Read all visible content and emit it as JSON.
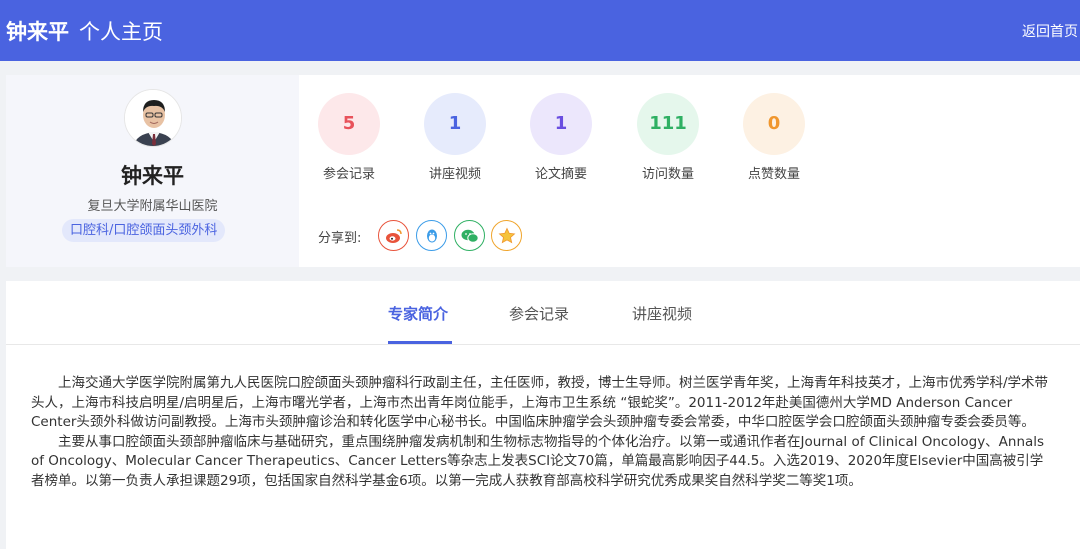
{
  "header": {
    "name": "钟来平",
    "subtitle": "个人主页",
    "back_label": "返回首页"
  },
  "profile": {
    "name": "钟来平",
    "hospital": "复旦大学附属华山医院",
    "department": "口腔科/口腔颌面头颈外科"
  },
  "stats": [
    {
      "value": "5",
      "label": "参会记录",
      "color": "#e8525b",
      "bg": "#fde8ea"
    },
    {
      "value": "1",
      "label": "讲座视频",
      "color": "#4a63e0",
      "bg": "#e6ebfc"
    },
    {
      "value": "1",
      "label": "论文摘要",
      "color": "#6a4ee0",
      "bg": "#ece7fc"
    },
    {
      "value": "111",
      "label": "访问数量",
      "color": "#2fb063",
      "bg": "#e5f7ec"
    },
    {
      "value": "0",
      "label": "点赞数量",
      "color": "#f0962d",
      "bg": "#fdf1e3"
    }
  ],
  "share": {
    "label": "分享到:",
    "targets": [
      {
        "name": "weibo",
        "color": "#e8533b"
      },
      {
        "name": "qq",
        "color": "#3b9ce8"
      },
      {
        "name": "wechat",
        "color": "#2fb063"
      },
      {
        "name": "favorite",
        "color": "#f0a52d"
      }
    ]
  },
  "tabs": [
    {
      "label": "专家简介",
      "active": true
    },
    {
      "label": "参会记录",
      "active": false
    },
    {
      "label": "讲座视频",
      "active": false
    }
  ],
  "bio": {
    "paragraph1": "上海交通大学医学院附属第九人民医院口腔颌面头颈肿瘤科行政副主任，主任医师，教授，博士生导师。树兰医学青年奖，上海青年科技英才，上海市优秀学科/学术带头人，上海市科技启明星/启明星后，上海市曙光学者，上海市杰出青年岗位能手，上海市卫生系统 “银蛇奖”。2011-2012年赴美国德州大学MD Anderson Cancer Center头颈外科做访问副教授。上海市头颈肿瘤诊治和转化医学中心秘书长。中国临床肿瘤学会头颈肿瘤专委会常委，中华口腔医学会口腔颌面头颈肿瘤专委会委员等。",
    "paragraph2": "主要从事口腔颌面头颈部肿瘤临床与基础研究，重点围绕肿瘤发病机制和生物标志物指导的个体化治疗。以第一或通讯作者在Journal of Clinical Oncology、Annals of Oncology、Molecular Cancer Therapeutics、Cancer Letters等杂志上发表SCI论文70篇，单篇最高影响因子44.5。入选2019、2020年度Elsevier中国高被引学者榜单。以第一负责人承担课题29项，包括国家自然科学基金6项。以第一完成人获教育部高校科学研究优秀成果奖自然科学奖二等奖1项。"
  }
}
